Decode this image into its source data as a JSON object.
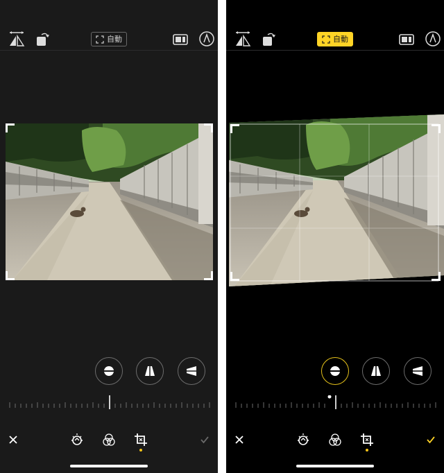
{
  "left_screen": {
    "auto_label": "自動",
    "top_icons": [
      "flip-horizontal-icon",
      "rotate-icon",
      "aspect-ratio-icon",
      "markup-icon"
    ],
    "adjust_buttons": [
      "straighten-icon",
      "vertical-perspective-icon",
      "horizontal-perspective-icon"
    ],
    "bottom_icons": [
      "close-icon",
      "adjust-icon",
      "filters-icon",
      "crop-icon",
      "done-icon"
    ],
    "colors": {
      "background": "#1a1a1a",
      "badge_border": "#6a6a6a",
      "selected_dot": "#f5c518"
    }
  },
  "right_screen": {
    "auto_label": "自動",
    "auto_active": true,
    "top_icons": [
      "flip-horizontal-icon",
      "rotate-icon",
      "aspect-ratio-icon",
      "markup-icon"
    ],
    "adjust_buttons": [
      "straighten-icon",
      "vertical-perspective-icon",
      "horizontal-perspective-icon"
    ],
    "active_adjust": "straighten-icon",
    "bottom_icons": [
      "close-icon",
      "adjust-icon",
      "filters-icon",
      "crop-icon",
      "done-icon"
    ],
    "colors": {
      "background": "#000000",
      "accent": "#ffd426",
      "selected_dot": "#f5c518"
    }
  }
}
